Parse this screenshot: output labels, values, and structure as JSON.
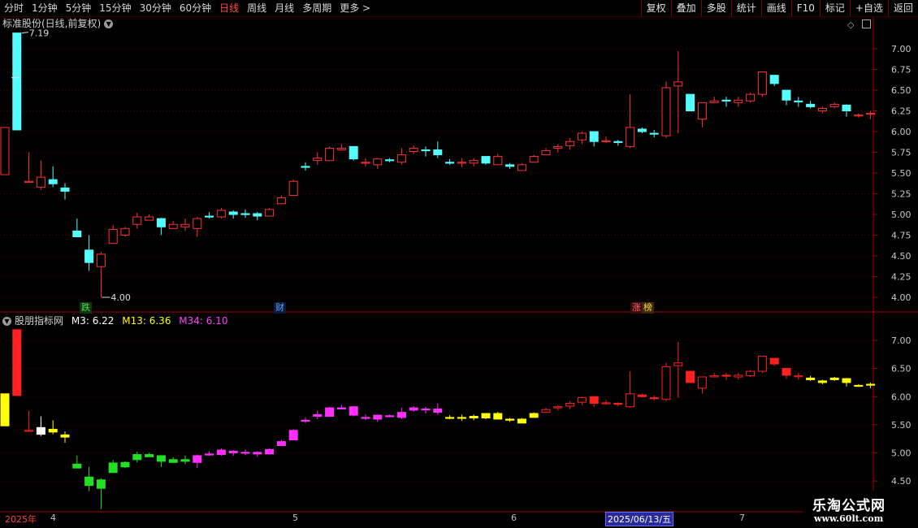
{
  "toolbar": {
    "periods": [
      "分时",
      "1分钟",
      "5分钟",
      "15分钟",
      "30分钟",
      "60分钟",
      "日线",
      "周线",
      "月线",
      "多周期",
      "更多 >"
    ],
    "active_period": "日线",
    "buttons": [
      "复权",
      "叠加",
      "多股",
      "统计",
      "画线",
      "F10",
      "标记",
      "+自选",
      "返回"
    ]
  },
  "main_panel": {
    "title": "标准股份(日线,前复权)",
    "max_label": "7.19",
    "min_label": "4.00",
    "price_ticks": [
      "7.00",
      "6.75",
      "6.50",
      "6.25",
      "6.00",
      "5.75",
      "5.50",
      "5.25",
      "5.00",
      "4.75",
      "4.50",
      "4.25",
      "4.00"
    ],
    "badges": [
      {
        "text": "跌",
        "color": "#5ad65a",
        "bg": "#0a3a0a"
      },
      {
        "text": "财",
        "color": "#5aa0ff",
        "bg": "#0a1a3a"
      },
      {
        "text": "涨",
        "color": "#ff6a6a",
        "bg": "#3a0a0a"
      },
      {
        "text": "榜",
        "color": "#ffd24a",
        "bg": "#3a2a0a"
      }
    ]
  },
  "indicator_panel": {
    "name": "股朋指标网",
    "m3": "M3: 6.22",
    "m13": "M13: 6.36",
    "m34": "M34: 6.10",
    "ticks": [
      "7.00",
      "6.50",
      "6.00",
      "5.50",
      "5.00",
      "4.50"
    ]
  },
  "date_axis": {
    "year_label": "2025年",
    "months": [
      "4",
      "5",
      "6",
      "7"
    ],
    "cursor_date": "2025/06/13/五"
  },
  "watermark": {
    "title": "乐淘公式网",
    "url": "www.60lt.com"
  },
  "colors": {
    "up": "#ff3232",
    "down": "#54fcfc",
    "grid": "#5a0000",
    "axis": "#a00000",
    "tick_text": "#c8c8c8",
    "m3": "#ffffff",
    "m13": "#ffff00",
    "m34": "#ff40ff"
  },
  "chart_data": {
    "type": "candlestick",
    "y_range": [
      4.0,
      7.2
    ],
    "candles": [
      {
        "o": 5.48,
        "h": 6.05,
        "l": 5.48,
        "c": 6.05,
        "col": "up",
        "ind": "yellow"
      },
      {
        "o": 7.19,
        "h": 7.19,
        "l": 6.02,
        "c": 6.02,
        "col": "down",
        "ind": "red"
      },
      {
        "o": 5.4,
        "h": 5.75,
        "l": 5.4,
        "c": 5.4,
        "col": "up",
        "ind": "red"
      },
      {
        "o": 5.33,
        "h": 5.65,
        "l": 5.3,
        "c": 5.45,
        "col": "up",
        "ind": "white"
      },
      {
        "o": 5.42,
        "h": 5.58,
        "l": 5.33,
        "c": 5.37,
        "col": "down",
        "ind": "yellow"
      },
      {
        "o": 5.32,
        "h": 5.38,
        "l": 5.18,
        "c": 5.28,
        "col": "down",
        "ind": "yellow"
      },
      {
        "o": 4.8,
        "h": 4.95,
        "l": 4.75,
        "c": 4.73,
        "col": "down",
        "ind": "green"
      },
      {
        "o": 4.57,
        "h": 4.75,
        "l": 4.32,
        "c": 4.42,
        "col": "down",
        "ind": "green"
      },
      {
        "o": 4.37,
        "h": 4.55,
        "l": 4.0,
        "c": 4.52,
        "col": "up",
        "ind": "green"
      },
      {
        "o": 4.65,
        "h": 4.87,
        "l": 4.65,
        "c": 4.82,
        "col": "up",
        "ind": "green"
      },
      {
        "o": 4.75,
        "h": 4.85,
        "l": 4.73,
        "c": 4.83,
        "col": "up",
        "ind": "green"
      },
      {
        "o": 4.88,
        "h": 5.02,
        "l": 4.83,
        "c": 4.97,
        "col": "up",
        "ind": "green"
      },
      {
        "o": 4.93,
        "h": 5.0,
        "l": 4.93,
        "c": 4.97,
        "col": "up",
        "ind": "green"
      },
      {
        "o": 4.95,
        "h": 4.96,
        "l": 4.75,
        "c": 4.85,
        "col": "down",
        "ind": "green"
      },
      {
        "o": 4.83,
        "h": 4.92,
        "l": 4.83,
        "c": 4.88,
        "col": "up",
        "ind": "green"
      },
      {
        "o": 4.85,
        "h": 4.95,
        "l": 4.8,
        "c": 4.88,
        "col": "up",
        "ind": "green"
      },
      {
        "o": 4.83,
        "h": 4.97,
        "l": 4.73,
        "c": 4.95,
        "col": "up",
        "ind": "magenta"
      },
      {
        "o": 4.98,
        "h": 5.03,
        "l": 4.95,
        "c": 4.98,
        "col": "down",
        "ind": "magenta"
      },
      {
        "o": 4.97,
        "h": 5.08,
        "l": 4.95,
        "c": 5.05,
        "col": "up",
        "ind": "magenta"
      },
      {
        "o": 5.03,
        "h": 5.05,
        "l": 4.95,
        "c": 5.0,
        "col": "down",
        "ind": "magenta"
      },
      {
        "o": 5.01,
        "h": 5.06,
        "l": 4.96,
        "c": 5.01,
        "col": "down",
        "ind": "magenta"
      },
      {
        "o": 5.01,
        "h": 5.03,
        "l": 4.93,
        "c": 4.98,
        "col": "down",
        "ind": "magenta"
      },
      {
        "o": 4.98,
        "h": 5.08,
        "l": 4.98,
        "c": 5.06,
        "col": "up",
        "ind": "magenta"
      },
      {
        "o": 5.13,
        "h": 5.23,
        "l": 5.13,
        "c": 5.2,
        "col": "up",
        "ind": "magenta"
      },
      {
        "o": 5.23,
        "h": 5.42,
        "l": 5.23,
        "c": 5.4,
        "col": "up",
        "ind": "magenta"
      },
      {
        "o": 5.58,
        "h": 5.63,
        "l": 5.53,
        "c": 5.58,
        "col": "down",
        "ind": "magenta"
      },
      {
        "o": 5.65,
        "h": 5.75,
        "l": 5.6,
        "c": 5.68,
        "col": "up",
        "ind": "magenta"
      },
      {
        "o": 5.65,
        "h": 5.82,
        "l": 5.65,
        "c": 5.8,
        "col": "up",
        "ind": "magenta"
      },
      {
        "o": 5.78,
        "h": 5.85,
        "l": 5.78,
        "c": 5.8,
        "col": "up",
        "ind": "magenta"
      },
      {
        "o": 5.82,
        "h": 5.82,
        "l": 5.65,
        "c": 5.67,
        "col": "down",
        "ind": "magenta"
      },
      {
        "o": 5.63,
        "h": 5.68,
        "l": 5.58,
        "c": 5.63,
        "col": "up",
        "ind": "magenta"
      },
      {
        "o": 5.6,
        "h": 5.68,
        "l": 5.55,
        "c": 5.67,
        "col": "up",
        "ind": "magenta"
      },
      {
        "o": 5.66,
        "h": 5.68,
        "l": 5.63,
        "c": 5.65,
        "col": "down",
        "ind": "magenta"
      },
      {
        "o": 5.63,
        "h": 5.8,
        "l": 5.6,
        "c": 5.72,
        "col": "up",
        "ind": "magenta"
      },
      {
        "o": 5.76,
        "h": 5.83,
        "l": 5.73,
        "c": 5.8,
        "col": "up",
        "ind": "magenta"
      },
      {
        "o": 5.78,
        "h": 5.82,
        "l": 5.7,
        "c": 5.77,
        "col": "down",
        "ind": "magenta"
      },
      {
        "o": 5.78,
        "h": 5.88,
        "l": 5.68,
        "c": 5.72,
        "col": "down",
        "ind": "magenta"
      },
      {
        "o": 5.63,
        "h": 5.67,
        "l": 5.6,
        "c": 5.62,
        "col": "down",
        "ind": "yellow"
      },
      {
        "o": 5.62,
        "h": 5.68,
        "l": 5.57,
        "c": 5.63,
        "col": "up",
        "ind": "yellow"
      },
      {
        "o": 5.62,
        "h": 5.68,
        "l": 5.58,
        "c": 5.65,
        "col": "up",
        "ind": "yellow"
      },
      {
        "o": 5.7,
        "h": 5.7,
        "l": 5.6,
        "c": 5.62,
        "col": "down",
        "ind": "yellow"
      },
      {
        "o": 5.6,
        "h": 5.73,
        "l": 5.6,
        "c": 5.7,
        "col": "up",
        "ind": "yellow"
      },
      {
        "o": 5.6,
        "h": 5.62,
        "l": 5.55,
        "c": 5.58,
        "col": "down",
        "ind": "yellow"
      },
      {
        "o": 5.53,
        "h": 5.62,
        "l": 5.53,
        "c": 5.6,
        "col": "up",
        "ind": "yellow"
      },
      {
        "o": 5.63,
        "h": 5.72,
        "l": 5.63,
        "c": 5.7,
        "col": "up",
        "ind": "yellow"
      },
      {
        "o": 5.72,
        "h": 5.8,
        "l": 5.72,
        "c": 5.77,
        "col": "up",
        "ind": "red"
      },
      {
        "o": 5.8,
        "h": 5.85,
        "l": 5.75,
        "c": 5.82,
        "col": "up",
        "ind": "red"
      },
      {
        "o": 5.83,
        "h": 5.92,
        "l": 5.78,
        "c": 5.88,
        "col": "up",
        "ind": "red"
      },
      {
        "o": 5.9,
        "h": 6.0,
        "l": 5.85,
        "c": 5.98,
        "col": "up",
        "ind": "red"
      },
      {
        "o": 6.0,
        "h": 6.0,
        "l": 5.82,
        "c": 5.88,
        "col": "down",
        "ind": "red"
      },
      {
        "o": 5.89,
        "h": 5.94,
        "l": 5.86,
        "c": 5.89,
        "col": "up",
        "ind": "red"
      },
      {
        "o": 5.88,
        "h": 5.9,
        "l": 5.83,
        "c": 5.87,
        "col": "down",
        "ind": "red"
      },
      {
        "o": 5.82,
        "h": 6.45,
        "l": 5.8,
        "c": 6.05,
        "col": "up",
        "ind": "red"
      },
      {
        "o": 6.03,
        "h": 6.05,
        "l": 5.98,
        "c": 6.0,
        "col": "down",
        "ind": "red"
      },
      {
        "o": 5.98,
        "h": 6.02,
        "l": 5.93,
        "c": 5.97,
        "col": "down",
        "ind": "red"
      },
      {
        "o": 5.95,
        "h": 6.6,
        "l": 5.92,
        "c": 6.53,
        "col": "up",
        "ind": "red"
      },
      {
        "o": 6.55,
        "h": 6.97,
        "l": 5.98,
        "c": 6.6,
        "col": "up",
        "ind": "red"
      },
      {
        "o": 6.45,
        "h": 6.45,
        "l": 6.25,
        "c": 6.25,
        "col": "down",
        "ind": "red"
      },
      {
        "o": 6.15,
        "h": 6.35,
        "l": 6.05,
        "c": 6.35,
        "col": "up",
        "ind": "red"
      },
      {
        "o": 6.35,
        "h": 6.42,
        "l": 6.35,
        "c": 6.37,
        "col": "up",
        "ind": "red"
      },
      {
        "o": 6.38,
        "h": 6.42,
        "l": 6.3,
        "c": 6.37,
        "col": "down",
        "ind": "red"
      },
      {
        "o": 6.35,
        "h": 6.42,
        "l": 6.3,
        "c": 6.38,
        "col": "up",
        "ind": "red"
      },
      {
        "o": 6.37,
        "h": 6.47,
        "l": 6.35,
        "c": 6.45,
        "col": "up",
        "ind": "red"
      },
      {
        "o": 6.45,
        "h": 6.72,
        "l": 6.42,
        "c": 6.72,
        "col": "up",
        "ind": "red"
      },
      {
        "o": 6.68,
        "h": 6.68,
        "l": 6.55,
        "c": 6.58,
        "col": "down",
        "ind": "red"
      },
      {
        "o": 6.5,
        "h": 6.5,
        "l": 6.32,
        "c": 6.38,
        "col": "down",
        "ind": "red"
      },
      {
        "o": 6.37,
        "h": 6.42,
        "l": 6.3,
        "c": 6.37,
        "col": "down",
        "ind": "red"
      },
      {
        "o": 6.33,
        "h": 6.37,
        "l": 6.28,
        "c": 6.3,
        "col": "down",
        "ind": "yellow"
      },
      {
        "o": 6.25,
        "h": 6.3,
        "l": 6.22,
        "c": 6.28,
        "col": "up",
        "ind": "yellow"
      },
      {
        "o": 6.3,
        "h": 6.35,
        "l": 6.28,
        "c": 6.33,
        "col": "up",
        "ind": "yellow"
      },
      {
        "o": 6.32,
        "h": 6.33,
        "l": 6.18,
        "c": 6.25,
        "col": "down",
        "ind": "yellow"
      },
      {
        "o": 6.2,
        "h": 6.22,
        "l": 6.17,
        "c": 6.2,
        "col": "up",
        "ind": "yellow"
      },
      {
        "o": 6.22,
        "h": 6.25,
        "l": 6.15,
        "c": 6.22,
        "col": "up",
        "ind": "yellow"
      }
    ]
  }
}
